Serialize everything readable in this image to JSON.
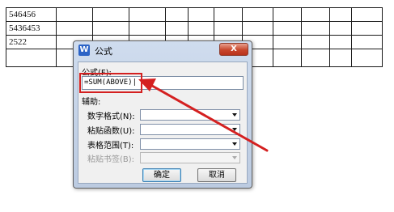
{
  "table": {
    "rows": [
      [
        "546456",
        "",
        "",
        "",
        "",
        "",
        "",
        "",
        "",
        "",
        "",
        ""
      ],
      [
        "5436453",
        "",
        "",
        "",
        "",
        "",
        "",
        "",
        "",
        "",
        "",
        ""
      ],
      [
        "2522",
        "",
        "",
        "",
        "",
        "",
        "",
        "",
        "",
        "",
        "",
        ""
      ],
      [
        "",
        "",
        "",
        "",
        "",
        "",
        "",
        "",
        "",
        "",
        "",
        ""
      ]
    ]
  },
  "dialog": {
    "icon_letter": "W",
    "title": "公式",
    "close_label": "X",
    "formula_label": "公式(F):",
    "formula_value": "=SUM(ABOVE)|",
    "assist_label": "辅助:",
    "number_format_label": "数字格式(N):",
    "number_format_value": "",
    "paste_function_label": "粘贴函数(U):",
    "paste_function_value": "",
    "table_range_label": "表格范围(T):",
    "table_range_value": "",
    "paste_bookmark_label": "粘贴书签(B):",
    "paste_bookmark_value": "",
    "ok_label": "确定",
    "cancel_label": "取消"
  },
  "colors": {
    "annotation": "#d42020",
    "accent": "#2b63c6"
  }
}
